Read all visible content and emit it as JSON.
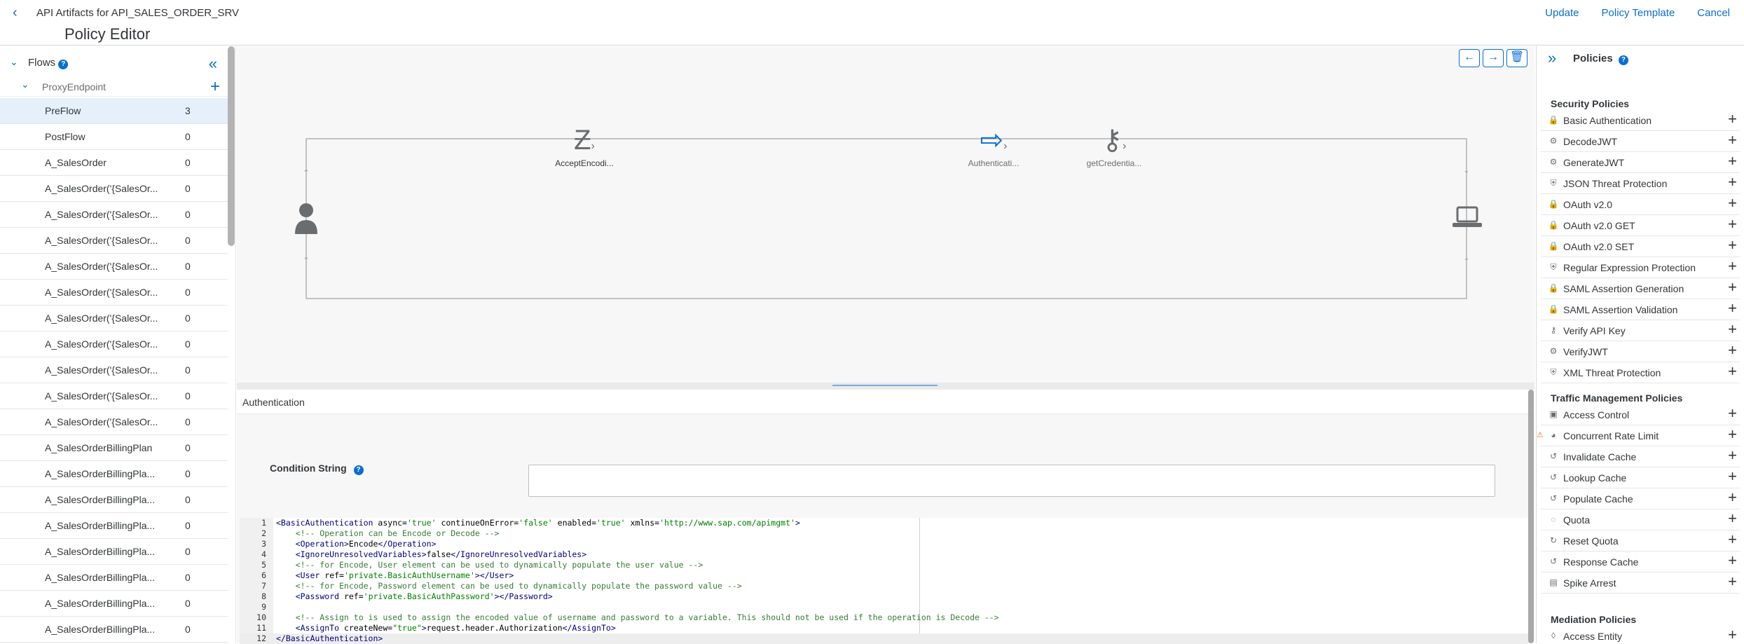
{
  "header": {
    "app_title": "API Artifacts for API_SALES_ORDER_SRV",
    "actions": [
      "Update",
      "Policy Template",
      "Cancel"
    ],
    "page_title": "Policy Editor"
  },
  "flows": {
    "title": "Flows",
    "help": "?",
    "proxy": "ProxyEndpoint",
    "items": [
      {
        "name": "PreFlow",
        "count": "3"
      },
      {
        "name": "PostFlow",
        "count": "0"
      },
      {
        "name": "A_SalesOrder",
        "count": "0"
      },
      {
        "name": "A_SalesOrder('{SalesOr...",
        "count": "0"
      },
      {
        "name": "A_SalesOrder('{SalesOr...",
        "count": "0"
      },
      {
        "name": "A_SalesOrder('{SalesOr...",
        "count": "0"
      },
      {
        "name": "A_SalesOrder('{SalesOr...",
        "count": "0"
      },
      {
        "name": "A_SalesOrder('{SalesOr...",
        "count": "0"
      },
      {
        "name": "A_SalesOrder('{SalesOr...",
        "count": "0"
      },
      {
        "name": "A_SalesOrder('{SalesOr...",
        "count": "0"
      },
      {
        "name": "A_SalesOrder('{SalesOr...",
        "count": "0"
      },
      {
        "name": "A_SalesOrder('{SalesOr...",
        "count": "0"
      },
      {
        "name": "A_SalesOrder('{SalesOr...",
        "count": "0"
      },
      {
        "name": "A_SalesOrderBillingPlan",
        "count": "0"
      },
      {
        "name": "A_SalesOrderBillingPla...",
        "count": "0"
      },
      {
        "name": "A_SalesOrderBillingPla...",
        "count": "0"
      },
      {
        "name": "A_SalesOrderBillingPla...",
        "count": "0"
      },
      {
        "name": "A_SalesOrderBillingPla...",
        "count": "0"
      },
      {
        "name": "A_SalesOrderBillingPla...",
        "count": "0"
      },
      {
        "name": "A_SalesOrderBillingPla...",
        "count": "0"
      },
      {
        "name": "A_SalesOrderBillingPla...",
        "count": "0"
      }
    ]
  },
  "canvas": {
    "policies": [
      {
        "label": "AcceptEncodi...",
        "icon": "zigzag-icon"
      },
      {
        "label": "getCredentia...",
        "icon": "key-icon"
      },
      {
        "label": "Authenticati...",
        "icon": "login-icon"
      }
    ]
  },
  "detail": {
    "title": "Authentication",
    "condition_label": "Condition String",
    "condition_value": ""
  },
  "code_lines": [
    "<BasicAuthentication async='true' continueOnError='false' enabled='true' xmlns='http://www.sap.com/apimgmt'>",
    "    <!-- Operation can be Encode or Decode -->",
    "    <Operation>Encode</Operation>",
    "    <IgnoreUnresolvedVariables>false</IgnoreUnresolvedVariables>",
    "    <!-- for Encode, User element can be used to dynamically populate the user value -->",
    "    <User ref='private.BasicAuthUsername'></User>",
    "    <!-- for Encode, Password element can be used to dynamically populate the password value -->",
    "    <Password ref='private.BasicAuthPassword'></Password>",
    "",
    "    <!-- Assign to is used to assign the encoded value of username and password to a variable. This should not be used if the operation is Decode -->",
    "    <AssignTo createNew=\"true\">request.header.Authorization</AssignTo>",
    "</BasicAuthentication>"
  ],
  "policies_panel": {
    "title": "Policies",
    "sections": [
      {
        "title": "Security Policies",
        "items": [
          {
            "name": "Basic Authentication",
            "icon": "lock-icon"
          },
          {
            "name": "DecodeJWT",
            "icon": "gear-icon"
          },
          {
            "name": "GenerateJWT",
            "icon": "gear-icon"
          },
          {
            "name": "JSON Threat Protection",
            "icon": "shield-icon"
          },
          {
            "name": "OAuth v2.0",
            "icon": "lock-icon"
          },
          {
            "name": "OAuth v2.0 GET",
            "icon": "lock-icon"
          },
          {
            "name": "OAuth v2.0 SET",
            "icon": "lock-icon"
          },
          {
            "name": "Regular Expression Protection",
            "icon": "shield-icon"
          },
          {
            "name": "SAML Assertion Generation",
            "icon": "lock-icon"
          },
          {
            "name": "SAML Assertion Validation",
            "icon": "lock-icon"
          },
          {
            "name": "Verify API Key",
            "icon": "key-icon"
          },
          {
            "name": "VerifyJWT",
            "icon": "gear-icon"
          },
          {
            "name": "XML Threat Protection",
            "icon": "shield-icon"
          }
        ]
      },
      {
        "title": "Traffic Management Policies",
        "items": [
          {
            "name": "Access Control",
            "icon": "doc-icon"
          },
          {
            "name": "Concurrent Rate Limit",
            "icon": "gauge-icon",
            "warning": true
          },
          {
            "name": "Invalidate Cache",
            "icon": "cache-icon"
          },
          {
            "name": "Lookup Cache",
            "icon": "cache-icon"
          },
          {
            "name": "Populate Cache",
            "icon": "cache-icon"
          },
          {
            "name": "Quota",
            "icon": "quota-icon"
          },
          {
            "name": "Reset Quota",
            "icon": "reset-icon"
          },
          {
            "name": "Response Cache",
            "icon": "cache-icon"
          },
          {
            "name": "Spike Arrest",
            "icon": "chart-icon"
          }
        ]
      },
      {
        "title": "Mediation Policies",
        "items": [
          {
            "name": "Access Entity",
            "icon": "entity-icon"
          }
        ]
      }
    ]
  },
  "colors": {
    "accent": "#0a6ed1",
    "selected_row": "#e5f0fa",
    "canvas_bg": "#f7f7f7"
  }
}
